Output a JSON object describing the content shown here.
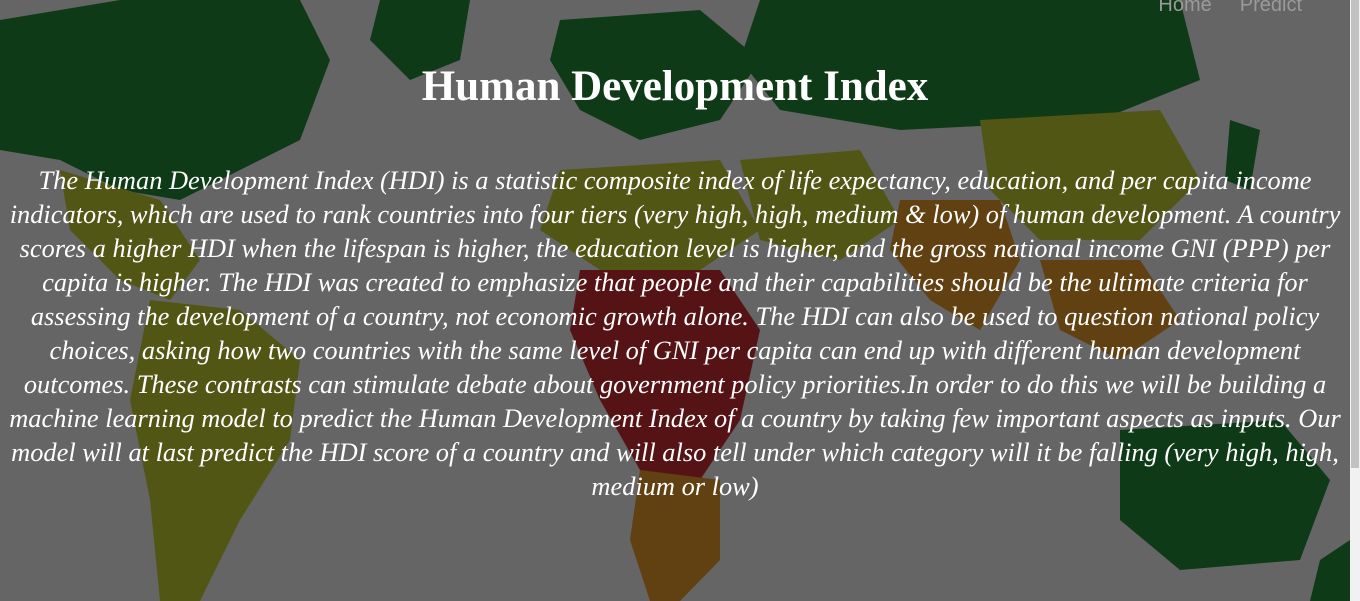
{
  "nav": {
    "items": [
      {
        "label": "Home"
      },
      {
        "label": "Predict"
      }
    ]
  },
  "header": {
    "title": "Human Development Index"
  },
  "main": {
    "description": "The Human Development Index (HDI) is a statistic composite index of life expectancy, education, and per capita income indicators, which are used to rank countries into four tiers (very high, high, medium & low) of human development. A country scores a higher HDI when the lifespan is higher, the education level is higher, and the gross national income GNI (PPP) per capita is higher. The HDI was created to emphasize that people and their capabilities should be the ultimate criteria for assessing the development of a country, not economic growth alone. The HDI can also be used to question national policy choices, asking how two countries with the same level of GNI per capita can end up with different human development outcomes. These contrasts can stimulate debate about government policy priorities.In order to do this we will be building a machine learning model to predict the Human Development Index of a country by taking few important aspects as inputs. Our model will at last predict the HDI score of a country and will also tell under which category will it be falling (very high, high, medium or low)"
  },
  "colors": {
    "very_high": "#0a7a1e",
    "high": "#b8c21a",
    "medium": "#e08a12",
    "low": "#c0141a",
    "ocean": "#e9e9e9"
  }
}
